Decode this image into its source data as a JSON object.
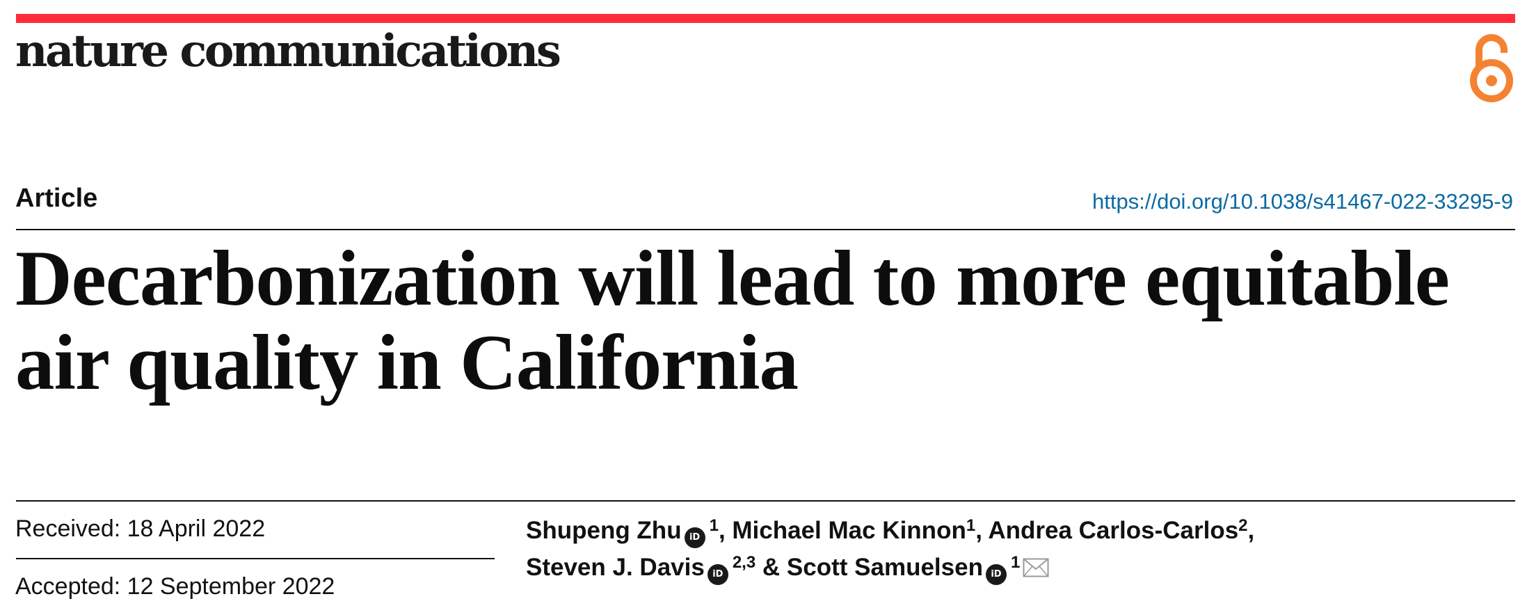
{
  "colors": {
    "top_bar": "#ff2d3a",
    "open_access_icon": "#f58233",
    "doi_link": "#0b6aa1",
    "orcid_badge": "#1a1a1a"
  },
  "header": {
    "journal_name": "nature communications",
    "open_access_icon": "open-access-lock-icon"
  },
  "article": {
    "type": "Article",
    "doi_url": "https://doi.org/10.1038/s41467-022-33295-9",
    "title_line_1": "Decarbonization will lead to more equitable",
    "title_line_2": "air quality in California"
  },
  "dates": {
    "received": "Received: 18 April 2022",
    "accepted": "Accepted: 12 September 2022"
  },
  "authors": [
    {
      "name": "Shupeng Zhu",
      "orcid": true,
      "affiliations": "1",
      "separator": ", "
    },
    {
      "name": "Michael Mac Kinnon",
      "orcid": false,
      "affiliations": "1",
      "separator": ", "
    },
    {
      "name": "Andrea Carlos-Carlos",
      "orcid": false,
      "affiliations": "2",
      "separator": ","
    },
    {
      "name": "Steven J. Davis",
      "orcid": true,
      "affiliations": "2,3",
      "separator": " & "
    },
    {
      "name": "Scott Samuelsen",
      "orcid": true,
      "affiliations": "1",
      "separator": "",
      "corresponding": true
    }
  ],
  "icons": {
    "orcid": "orcid-icon",
    "orcid_glyph": "iD",
    "corresponding": "envelope-icon"
  }
}
